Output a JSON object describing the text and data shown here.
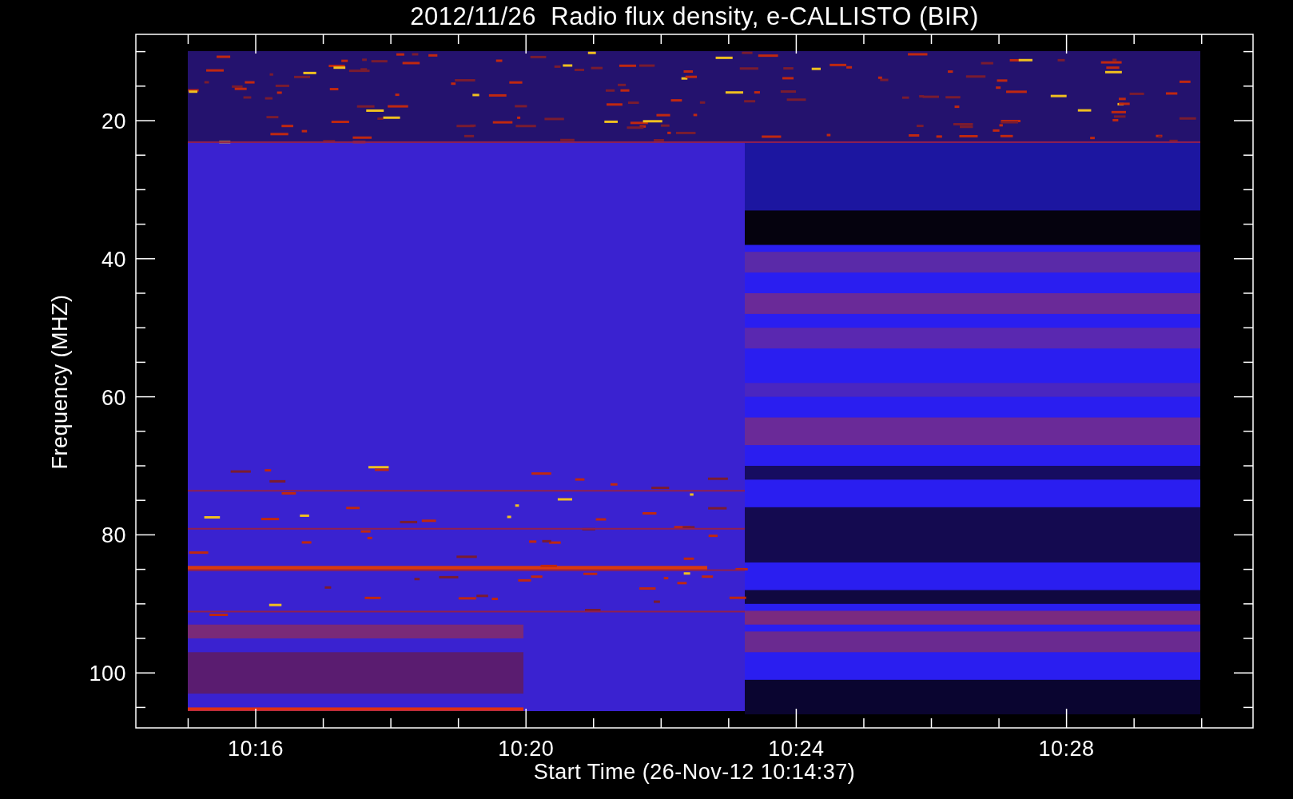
{
  "title": "2012/11/26  Radio flux density, e-CALLISTO (BIR)",
  "y_axis": {
    "label": "Frequency (MHZ)",
    "ticks": [
      "20",
      "40",
      "60",
      "80",
      "100"
    ]
  },
  "x_axis": {
    "label": "Start Time (26-Nov-12 10:14:37)",
    "ticks": [
      "10:16",
      "10:20",
      "10:24",
      "10:28"
    ]
  }
}
